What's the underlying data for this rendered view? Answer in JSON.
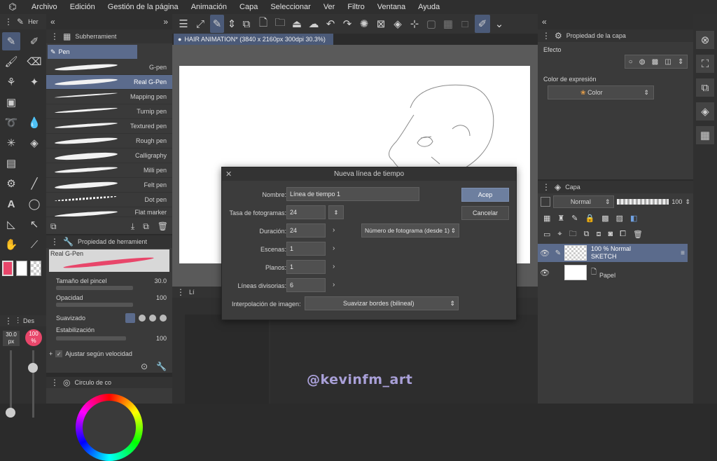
{
  "menu": {
    "items": [
      "Archivo",
      "Edición",
      "Gestión de la página",
      "Animación",
      "Capa",
      "Seleccionar",
      "Ver",
      "Filtro",
      "Ventana",
      "Ayuda"
    ]
  },
  "document_tab": "HAIR ANIMATION* (3840 x 2160px 300dpi 30.3%)",
  "left": {
    "tool_tab": "Her",
    "subtool_tab": "Subherramient",
    "subtool_group": "Pen",
    "brushes": [
      "G-pen",
      "Real G-Pen",
      "Mapping pen",
      "Turnip pen",
      "Textured pen",
      "Rough pen",
      "Calligraphy",
      "Milli pen",
      "Felt pen",
      "Dot pen",
      "Flat marker"
    ],
    "selected_brush_index": 1,
    "tool_property_tab": "Propiedad de herramient",
    "tool_property_name": "Real G-Pen",
    "brush_size_label": "Tamaño del pincel",
    "brush_size_value": "30.0",
    "opacity_label": "Opacidad",
    "opacity_value": "100",
    "smoothing_label": "Suavizado",
    "stabilization_label": "Estabilización",
    "stabilization_value": "100",
    "velocity_label": "Ajustar según velocidad",
    "brush_size_indicator": "30.0",
    "brush_size_unit": "px",
    "opacity_indicator": "100",
    "opacity_unit": "%",
    "color_tab": "Circulo de co",
    "des_tab": "Des"
  },
  "dialog": {
    "title": "Nueva línea de tiempo",
    "name_label": "Nombre:",
    "name_value": "Línea de tiempo 1",
    "fps_label": "Tasa de fotogramas:",
    "fps_value": "24",
    "duration_label": "Duración:",
    "duration_value": "24",
    "frame_number_option": "Número de fotograma (desde 1)",
    "scenes_label": "Escenas:",
    "scenes_value": "1",
    "planes_label": "Planos:",
    "planes_value": "1",
    "divider_label": "Líneas divisorias:",
    "divider_value": "6",
    "interp_label": "Interpolación de imagen:",
    "interp_value": "Suavizar bordes (bilineal)",
    "ok_label": "Acep",
    "cancel_label": "Cancelar"
  },
  "timeline_tab": "Lí",
  "right": {
    "layer_property_tab": "Propiedad de la capa",
    "effect_label": "Efecto",
    "expression_color_label": "Color de expresión",
    "expression_color_value": "Color",
    "layer_tab": "Capa",
    "blend_mode": "Normal",
    "layer_opacity": "100",
    "layers": [
      {
        "opacity_blend": "100 %  Normal",
        "name": "SKETCH",
        "selected": true
      },
      {
        "opacity_blend": "",
        "name": "Papel",
        "selected": false
      }
    ]
  },
  "watermark": "@kevinfm_art",
  "colors": {
    "accent": "#5b6b8c",
    "primary_button": "#6d7f9f",
    "main_color": "#e8466a",
    "watermark": "#a9a0d8"
  }
}
